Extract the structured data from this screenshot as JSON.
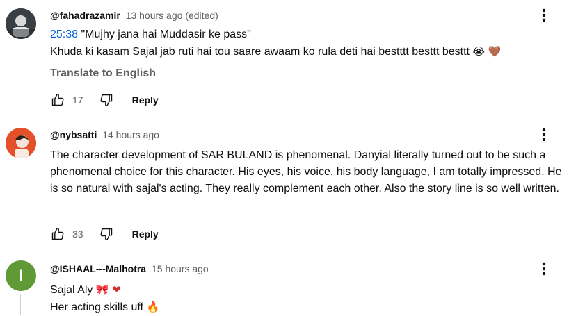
{
  "comments": [
    {
      "handle": "@fahadrazamir",
      "time": "13 hours ago (edited)",
      "timestamp_link": "25:38",
      "line1_rest": " \"Mujhy jana hai Muddasir ke pass\"",
      "line2": "Khuda ki kasam Sajal jab ruti hai tou saare awaam ko rula deti hai bestttt besttt besttt",
      "emoji": "😭 🤎",
      "translate": "Translate to English",
      "likes": "17",
      "reply": "Reply"
    },
    {
      "handle": "@nybsatti",
      "time": "14 hours ago",
      "text": "The character development of SAR BULAND is phenomenal.  Danyial literally turned out to be such a phenomenal choice for this character.  His eyes, his voice, his body language,  I am totally impressed.  He is so natural with sajal's acting. They really complement each other. Also the story line is so well written.",
      "likes": "33",
      "reply": "Reply"
    },
    {
      "handle": "@ISHAAL---Malhotra",
      "time": "15 hours ago",
      "avatar_letter": "I",
      "avatar_color": "#5f9a36",
      "line1": "Sajal Aly",
      "line1_emoji": "🎀 ❤",
      "line2": "Her acting skills uff",
      "line2_emoji": "🔥"
    }
  ],
  "colors": {
    "link": "#065fd4",
    "secondary": "#606060"
  }
}
